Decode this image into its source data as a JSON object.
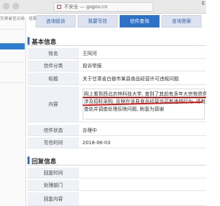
{
  "browser": {
    "url": "不安全 — gsgov.cn",
    "corner": "E"
  },
  "breadcrumb": "甘肃省信访局 · 信箱回复",
  "tabs": [
    {
      "label": "咨询投诉",
      "active": false
    },
    {
      "label": "我要写信",
      "active": false
    },
    {
      "label": "信件查询",
      "active": true
    },
    {
      "label": "咨询答案",
      "active": false
    }
  ],
  "basic": {
    "title": "基本信息",
    "rows": [
      {
        "label": "姓名",
        "value": "王同河"
      },
      {
        "label": "信件分类",
        "value": "投诉举报"
      },
      {
        "label": "标题",
        "value": "关于甘肃省白银市某县食品经营许可违规问题"
      },
      {
        "label": "内容",
        "lines": [
          "网上看到西北农林科技大学, 查到了其前有多年大宗物资供应商",
          "涉及招标采购, 反映在该县食品经营许可有违规行为, 请有关部门",
          "查处并调查处理反映问题, 盼复为感谢"
        ]
      },
      {
        "label": "信件状态",
        "value": "办理中"
      },
      {
        "label": "写信时间",
        "value": "2018-06-03"
      }
    ]
  },
  "reply": {
    "title": "回复信息",
    "rows": [
      {
        "label": "回复时间",
        "value": ""
      },
      {
        "label": "处理部门",
        "value": ""
      },
      {
        "label": "回复内容",
        "value": ""
      }
    ]
  },
  "colors": {
    "accent": "#2e72c8",
    "highlight": "#e01010"
  }
}
